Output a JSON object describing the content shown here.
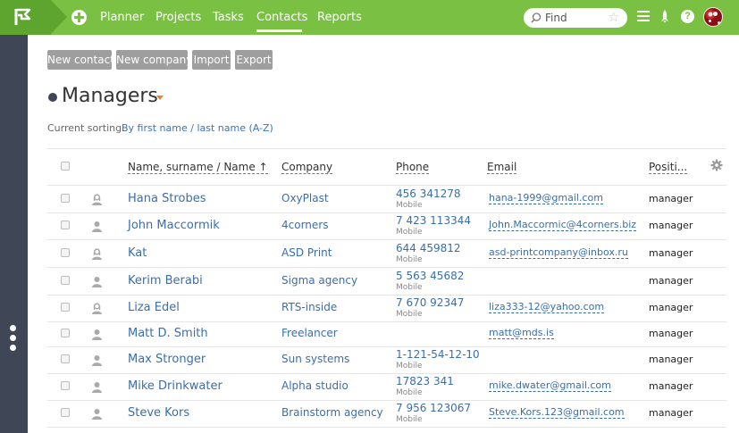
{
  "nav": {
    "tabs": [
      {
        "label": "Planner"
      },
      {
        "label": "Projects"
      },
      {
        "label": "Tasks"
      },
      {
        "label": "Contacts",
        "active": true
      },
      {
        "label": "Reports"
      }
    ],
    "search_placeholder": "Find"
  },
  "toolbar": {
    "new_contact": "New contact",
    "new_company": "New company",
    "import": "Import",
    "export": "Export"
  },
  "page": {
    "title": "Managers",
    "sorting_label": "Current sorting:",
    "sorting_value": "By first name / last name (A-Z)"
  },
  "table": {
    "columns": [
      "Name, surname / Name ↑",
      "Company",
      "Phone",
      "Email",
      "Positi..."
    ],
    "rows": [
      {
        "name": "Hana Strobes",
        "company": "OxyPlast",
        "phone": "456 341278",
        "phone_type": "Mobile",
        "email": "hana-1999@gmail.com",
        "position": "manager",
        "icon": "user-female-icon"
      },
      {
        "name": "John Maccormik",
        "company": "4corners",
        "phone": "7 423 113344",
        "phone_type": "Mobile",
        "email": "John.Maccormic@4corners.biz",
        "position": "manager",
        "icon": "user-icon"
      },
      {
        "name": "Kat",
        "company": "ASD Print",
        "phone": "644 459812",
        "phone_type": "Mobile",
        "email": "asd-printcompany@inbox.ru",
        "position": "manager",
        "icon": "user-female-icon"
      },
      {
        "name": "Kerim Berabi",
        "company": "Sigma agency",
        "phone": "5 563 45682",
        "phone_type": "Mobile",
        "email": "",
        "position": "manager",
        "icon": "user-icon"
      },
      {
        "name": "Liza Edel",
        "company": "RTS-inside",
        "phone": "7 670 92347",
        "phone_type": "Mobile",
        "email": "liza333-12@yahoo.com",
        "position": "manager",
        "icon": "user-female-icon"
      },
      {
        "name": "Matt D. Smith",
        "company": "Freelancer",
        "phone": "",
        "phone_type": "",
        "email": "matt@mds.is",
        "position": "manager",
        "icon": "user-icon"
      },
      {
        "name": "Max Stronger",
        "company": "Sun systems",
        "phone": "1-121-54-12-10",
        "phone_type": "Mobile",
        "email": "",
        "position": "manager",
        "icon": "user-icon"
      },
      {
        "name": "Mike Drinkwater",
        "company": "Alpha studio",
        "phone": "17823 341",
        "phone_type": "Mobile",
        "email": "mike.dwater@gmail.com",
        "position": "manager",
        "icon": "user-icon"
      },
      {
        "name": "Steve Kors",
        "company": "Brainstorm agency",
        "phone": "7 956 123067",
        "phone_type": "Mobile",
        "email": "Steve.Kors.123@gmail.com",
        "position": "manager",
        "icon": "user-icon"
      }
    ]
  },
  "colors": {
    "topbar": "#7ac143",
    "rail": "#3f4757",
    "link": "#3b6ea8",
    "accent": "#e8822a"
  }
}
